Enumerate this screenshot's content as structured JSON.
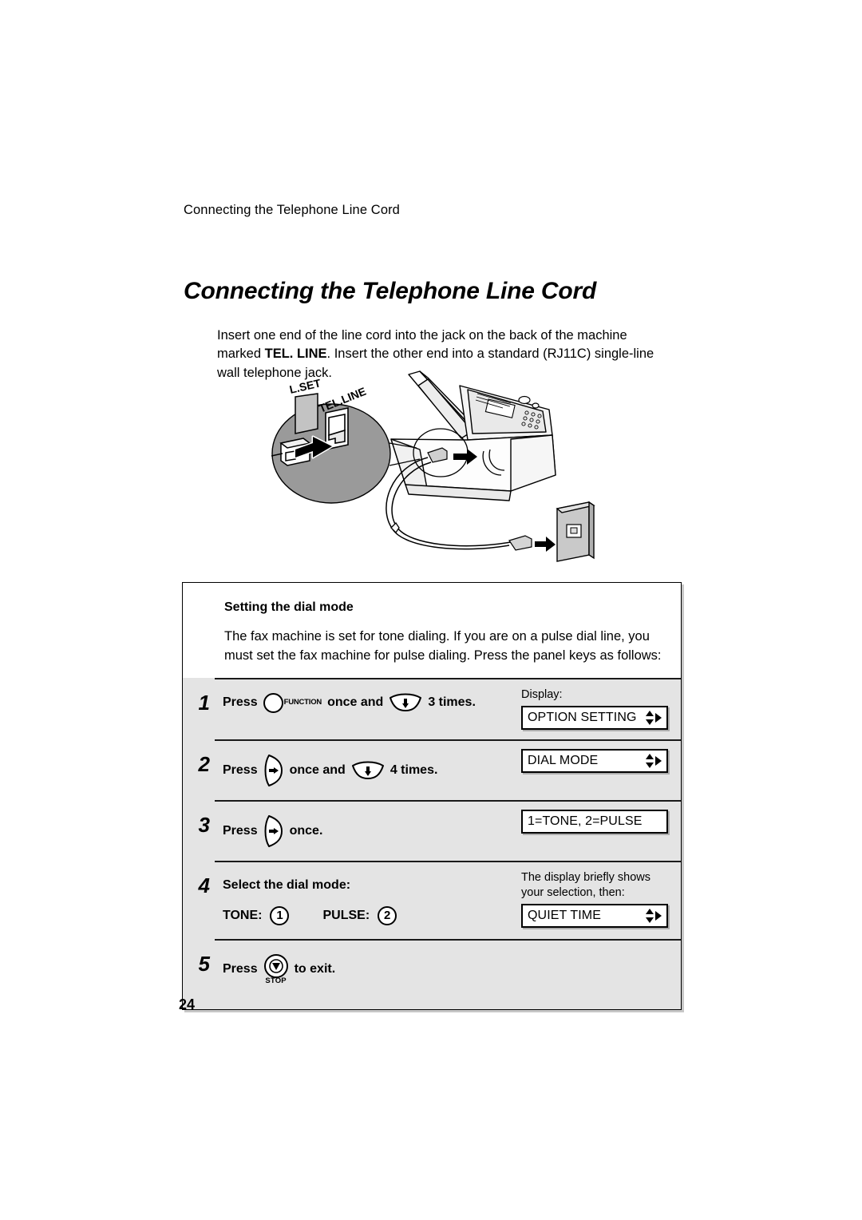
{
  "header": {
    "running_title": "Connecting the Telephone Line Cord"
  },
  "title": "Connecting the Telephone Line Cord",
  "intro": {
    "part1": "Insert one end of the line cord into the jack on the back of the machine marked ",
    "bold": "TEL. LINE",
    "part2": ". Insert the other end into a standard (RJ11C) single-line wall telephone jack."
  },
  "illustration": {
    "inset_label_left": "L.SET",
    "inset_label_right": "TEL.LINE",
    "alt": "Fax machine rear jack with magnified inset and wall telephone jack"
  },
  "procedure": {
    "heading": "Setting the dial mode",
    "body": "The fax machine is set for tone dialing. If you are on a pulse dial line, you must set the fax machine for pulse dialing. Press the panel keys as follows:",
    "steps": [
      {
        "number": "1",
        "press_label": "Press",
        "key1": "FUNCTION",
        "mid_text": "once and",
        "key2": "down-arrow-key",
        "count_text": "3 times.",
        "display_caption": "Display:",
        "lcd_text": "OPTION SETTING",
        "lcd_arrows": true
      },
      {
        "number": "2",
        "press_label": "Press",
        "key1": "right-arrow-key",
        "mid_text": "once and",
        "key2": "down-arrow-key",
        "count_text": "4 times.",
        "display_caption": "",
        "lcd_text": "DIAL MODE",
        "lcd_arrows": true
      },
      {
        "number": "3",
        "press_label": "Press",
        "key1": "right-arrow-key",
        "mid_text": "",
        "key2": "",
        "count_text": "once.",
        "display_caption": "",
        "lcd_text": "1=TONE, 2=PULSE",
        "lcd_arrows": false
      },
      {
        "number": "4",
        "select_label": "Select the dial mode:",
        "tone_label": "TONE:",
        "tone_key": "1",
        "pulse_label": "PULSE:",
        "pulse_key": "2",
        "display_caption": "The display briefly shows your selection, then:",
        "lcd_text": "QUIET TIME",
        "lcd_arrows": true
      },
      {
        "number": "5",
        "press_label": "Press",
        "key_stop": "STOP",
        "tail_text": "to exit."
      }
    ]
  },
  "page_number": "24",
  "colors": {
    "step_background": "#e4e4e4",
    "inset_fill": "#9a9a9a",
    "text": "#000000",
    "panel_fill": "#d8d8d8"
  }
}
